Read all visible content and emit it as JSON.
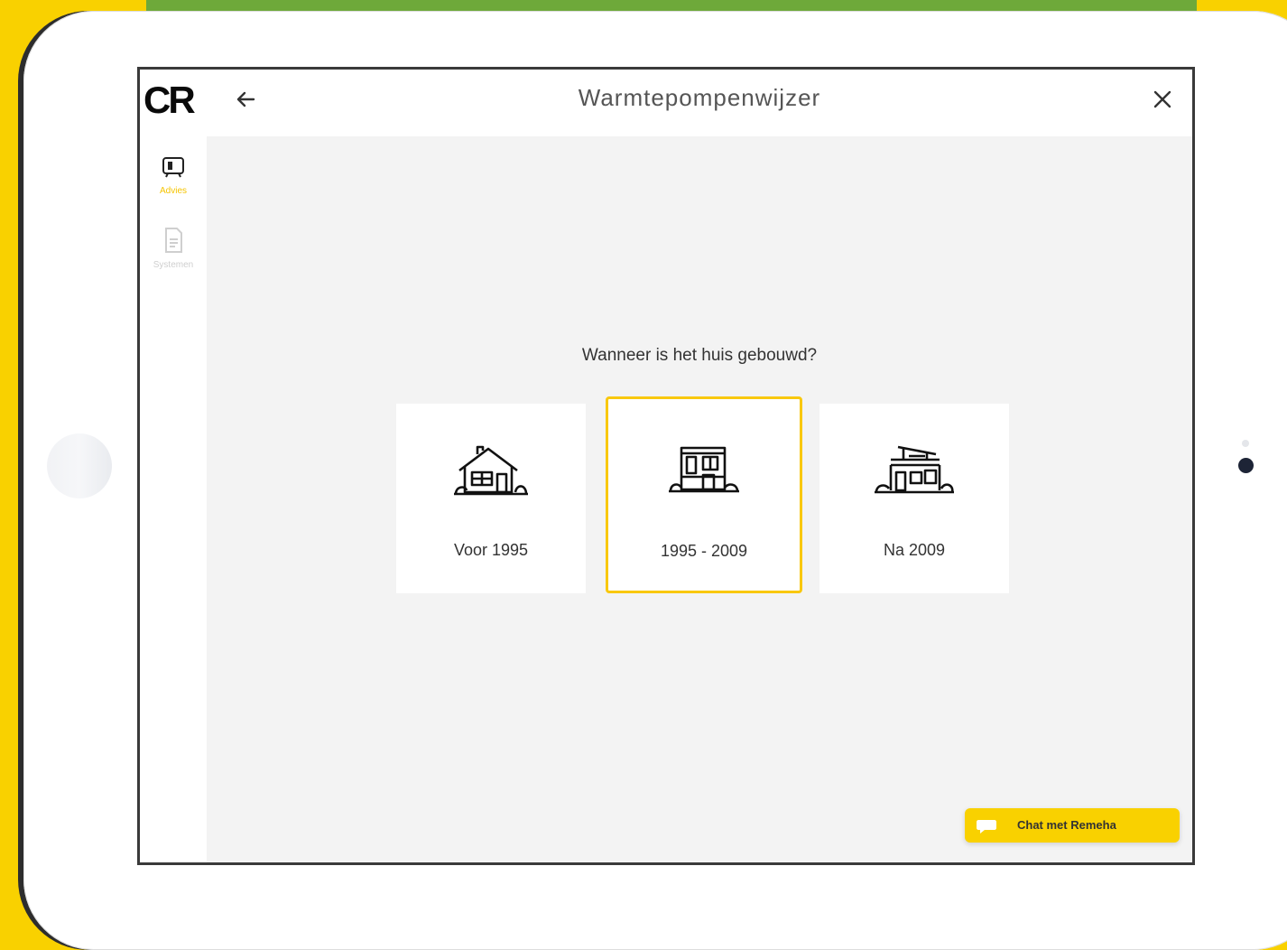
{
  "app": {
    "title": "Warmtepompenwijzer",
    "logo_text": "CR"
  },
  "sidebar": {
    "items": [
      {
        "label": "Advies",
        "icon": "advice-icon",
        "active": true
      },
      {
        "label": "Systemen",
        "icon": "document-icon",
        "active": false
      }
    ]
  },
  "question": {
    "text": "Wanneer is het huis gebouwd?",
    "options": [
      {
        "label": "Voor 1995",
        "icon": "traditional-house-icon",
        "selected": false
      },
      {
        "label": "1995 - 2009",
        "icon": "modern-house-icon",
        "selected": true
      },
      {
        "label": "Na 2009",
        "icon": "contemporary-house-icon",
        "selected": false
      }
    ]
  },
  "chat": {
    "label": "Chat met Remeha",
    "icon": "chat-bubble-icon"
  },
  "colors": {
    "accent": "#F9D100",
    "background_band": "#6EA93A",
    "selected_border": "#F9C80E",
    "active_nav": "#F5C400"
  }
}
